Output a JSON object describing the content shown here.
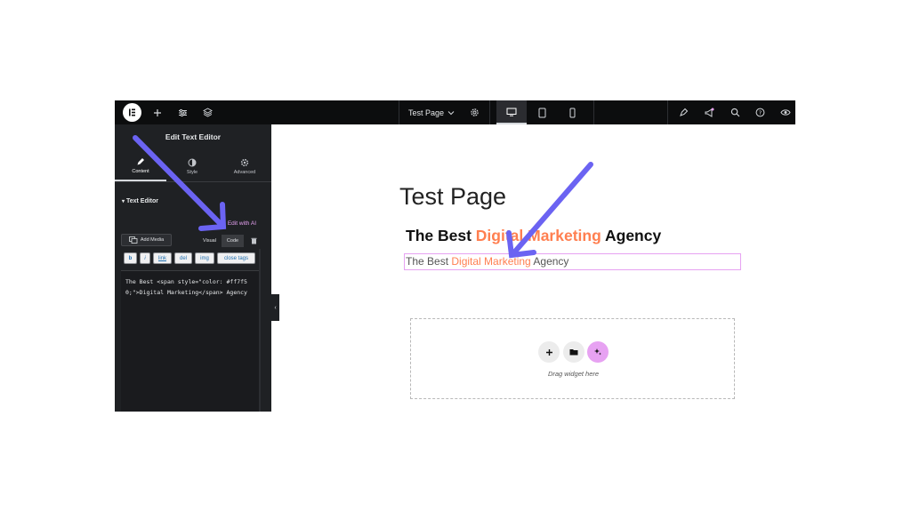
{
  "topbar": {
    "page_title": "Test Page"
  },
  "panel": {
    "title": "Edit Text Editor",
    "tabs": [
      {
        "label": "Content"
      },
      {
        "label": "Style"
      },
      {
        "label": "Advanced"
      }
    ],
    "section_title": "Text Editor",
    "edit_with_ai": "Edit with AI",
    "add_media": "Add Media",
    "view_tabs": {
      "visual": "Visual",
      "code": "Code"
    },
    "quicktags": [
      "b",
      "i",
      "link",
      "del",
      "img",
      "close tags"
    ],
    "code_content": "The Best <span style=\"color: #ff7f50;\">Digital Marketing</span> Agency"
  },
  "canvas": {
    "page_title": "Test Page",
    "heading": {
      "before": "The Best ",
      "highlight": "Digital Marketing",
      "after": " Agency"
    },
    "text": {
      "before": "The Best ",
      "highlight": "Digital Marketing",
      "after": " Agency"
    },
    "dropzone_text": "Drag widget here"
  },
  "colors": {
    "accent": "#ff7f50",
    "ai_pink": "#e7a2f2",
    "arrow": "#6b63f2",
    "panel_bg": "#1f2124",
    "topbar_bg": "#0c0d0e"
  },
  "icons": [
    "elementor-logo-icon",
    "plus-icon",
    "sliders-icon",
    "layers-icon",
    "chevron-down-icon",
    "gear-icon",
    "desktop-icon",
    "tablet-icon",
    "mobile-icon",
    "pen-nib-icon",
    "megaphone-icon",
    "search-icon",
    "help-icon",
    "eye-icon",
    "pencil-icon",
    "contrast-icon",
    "cog-icon",
    "caret-down-icon",
    "sparkle-icon",
    "media-icon",
    "trash-icon",
    "chevron-left-icon",
    "folder-icon",
    "annotation-arrow"
  ]
}
